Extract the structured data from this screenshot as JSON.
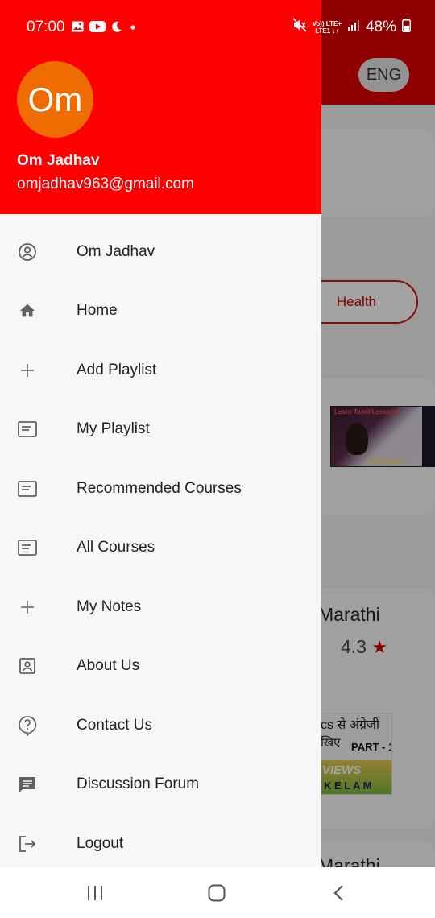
{
  "status_bar": {
    "time": "07:00",
    "left_icons": [
      "gallery-icon",
      "youtube-icon",
      "moon-icon",
      "dot-icon"
    ],
    "network_label_top": "Vo)) LTE+",
    "network_label_bottom": "LTE1 ↓↑",
    "battery_percent": "48%"
  },
  "drawer": {
    "avatar_initials": "Om",
    "avatar_color": "#ef6c00",
    "header_color": "#ff0000",
    "user_name": "Om Jadhav",
    "user_email": "omjadhav963@gmail.com",
    "items": [
      {
        "label": "Om Jadhav",
        "icon": "account-circle-icon"
      },
      {
        "label": "Home",
        "icon": "home-icon"
      },
      {
        "label": "Add Playlist",
        "icon": "plus-icon"
      },
      {
        "label": "My Playlist",
        "icon": "list-box-icon"
      },
      {
        "label": "Recommended Courses",
        "icon": "list-box-icon"
      },
      {
        "label": "All Courses",
        "icon": "list-box-icon"
      },
      {
        "label": "My Notes",
        "icon": "plus-icon"
      },
      {
        "label": "About Us",
        "icon": "contact-card-icon"
      },
      {
        "label": "Contact Us",
        "icon": "help-bubble-icon"
      },
      {
        "label": "Discussion Forum",
        "icon": "chat-icon"
      },
      {
        "label": "Logout",
        "icon": "logout-icon"
      }
    ]
  },
  "background_app": {
    "language_button": "ENG",
    "category_chip": "Health",
    "thumb1_title": "Learn Tamil Lesson 1",
    "thumb1_subtitle": "Ezhuthukal",
    "course_title_1": "Marathi",
    "course_rating": "4.3",
    "thumb2_line1": "cs से अंग्रेजी",
    "thumb2_line2": "खिए",
    "thumb2_part": "PART - 1",
    "thumb2_word1": "VIEWS",
    "thumb2_word2": "K E L A M",
    "course_title_2": "Marathi"
  },
  "nav_bar": {
    "buttons": [
      "recent-apps-icon",
      "home-button-icon",
      "back-icon"
    ]
  }
}
